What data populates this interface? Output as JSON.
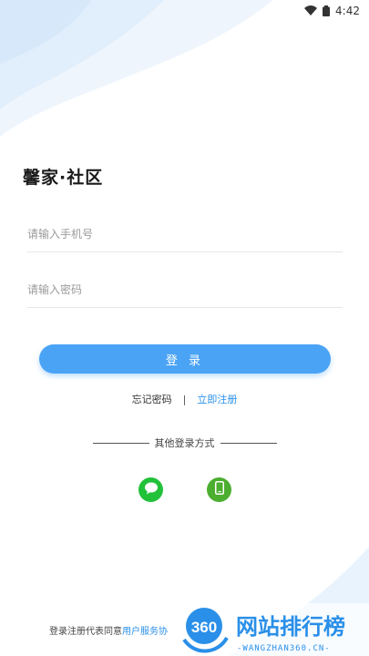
{
  "status_bar": {
    "time": "4:42",
    "icons": [
      "wifi-icon",
      "battery-icon"
    ]
  },
  "app": {
    "title": "馨家·社区"
  },
  "form": {
    "phone_placeholder": "请输入手机号",
    "password_placeholder": "请输入密码",
    "login_label": "登 录"
  },
  "links": {
    "forgot": "忘记密码",
    "separator": "|",
    "register": "立即注册"
  },
  "other_login": {
    "label": "其他登录方式",
    "methods": [
      "wechat-icon",
      "phone-icon"
    ]
  },
  "agreement": {
    "prefix": "登录注册代表同意",
    "user_agreement": "用户服务协"
  },
  "watermark": {
    "logo": "360",
    "text": "网站排行榜",
    "sub": "-WANGZHAN360.CN-"
  },
  "colors": {
    "primary": "#4aa3f5",
    "link": "#2a8fe8",
    "wechat": "#22c13a",
    "phone": "#4cae30"
  }
}
